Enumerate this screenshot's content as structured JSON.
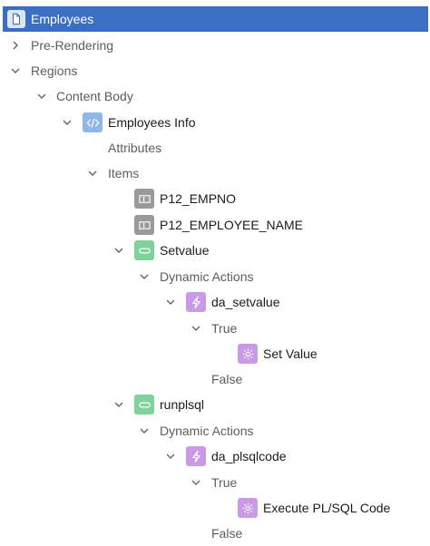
{
  "tree": {
    "root": "Employees",
    "pre_rendering": "Pre-Rendering",
    "regions": "Regions",
    "content_body": "Content Body",
    "employees_info": "Employees Info",
    "attributes": "Attributes",
    "items": "Items",
    "p12_empno": "P12_EMPNO",
    "p12_employee_name": "P12_EMPLOYEE_NAME",
    "setvalue": "Setvalue",
    "dynamic_actions_1": "Dynamic Actions",
    "da_setvalue": "da_setvalue",
    "true_1": "True",
    "set_value": "Set Value",
    "false_1": "False",
    "runplsql": "runplsql",
    "dynamic_actions_2": "Dynamic Actions",
    "da_plsqlcode": "da_plsqlcode",
    "true_2": "True",
    "execute_plsql": "Execute PL/SQL Code",
    "false_2": "False"
  },
  "colors": {
    "selection": "#3a6fc4",
    "region_icon": "#8fb7e8",
    "item_icon": "#9a9a9a",
    "button_icon": "#7fd29a",
    "dynamic_action_icon": "#c99be6",
    "action_icon": "#c99be6"
  }
}
